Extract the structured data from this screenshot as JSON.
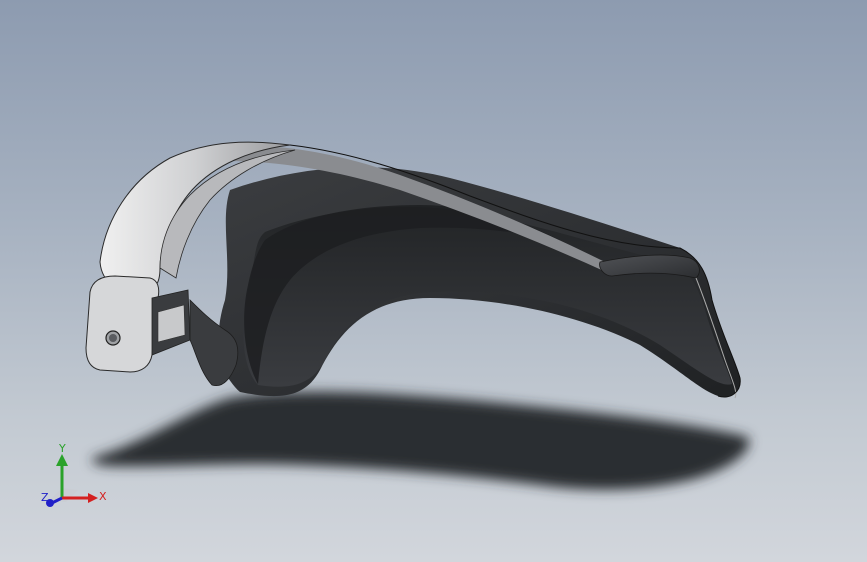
{
  "viewport": {
    "background_top": "#8d9bb0",
    "background_bottom": "#d2d6dc"
  },
  "model": {
    "body_color": "#2e3033",
    "highlight_color": "#d8d9db",
    "shadow_color": "#2a2c30"
  },
  "triad": {
    "x_label": "X",
    "y_label": "Y",
    "z_label": "Z",
    "x_color": "#d42020",
    "y_color": "#2aa22a",
    "z_color": "#2020c8"
  }
}
